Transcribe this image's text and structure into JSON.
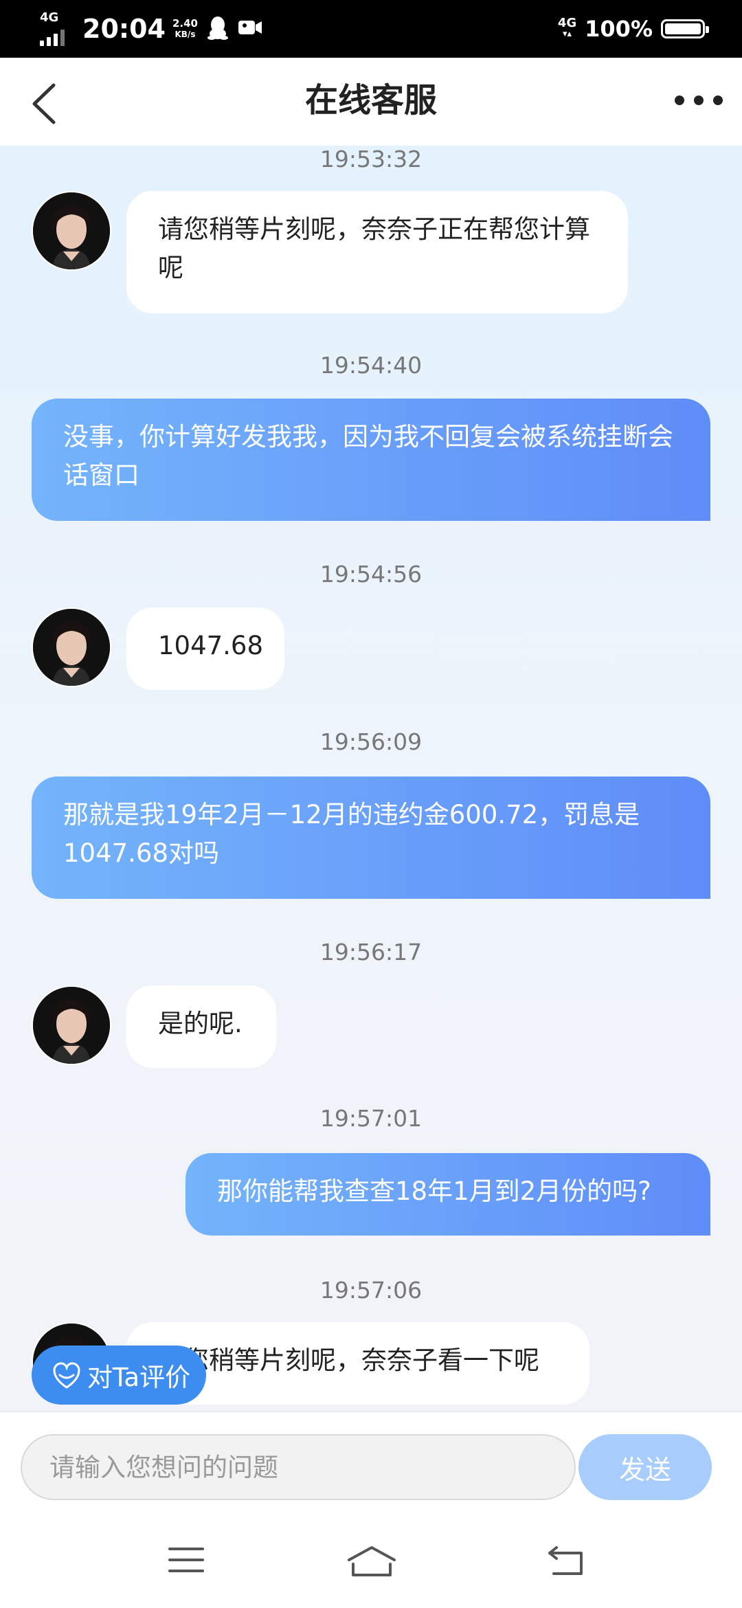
{
  "status_bar": {
    "network_left": "4G",
    "time": "20:04",
    "speed_value": "2.40",
    "speed_unit": "KB/s",
    "network_right": "4G",
    "battery_pct": "100%",
    "battery_level": 1.0
  },
  "header": {
    "title": "在线客服"
  },
  "messages": [
    {
      "time": "19:53:32",
      "from": "agent",
      "text": "请您稍等片刻呢，奈奈子正在帮您计算呢"
    },
    {
      "time": "19:54:40",
      "from": "user",
      "text": "没事，你计算好发我我，因为我不回复会被系统挂断会话窗口"
    },
    {
      "time": "19:54:56",
      "from": "agent",
      "text": "1047.68"
    },
    {
      "time": "19:56:09",
      "from": "user",
      "text": "那就是我19年2月－12月的违约金600.72，罚息是1047.68对吗"
    },
    {
      "time": "19:56:17",
      "from": "agent",
      "text": "是的呢."
    },
    {
      "time": "19:57:01",
      "from": "user",
      "text": "那你能帮我查查18年1月到2月份的吗?"
    },
    {
      "time": "19:57:06",
      "from": "agent",
      "text": "请您稍等片刻呢，奈奈子看一下呢"
    }
  ],
  "rate_button": {
    "label": "对Ta评价"
  },
  "input": {
    "placeholder": "请输入您想问的问题",
    "value": ""
  },
  "send_button": {
    "label": "发送"
  },
  "colors": {
    "outgoing_bubble_start": "#74b4fb",
    "outgoing_bubble_end": "#5f8df8",
    "send_button": "#a8cdfc",
    "rate_button": "#3d8df0"
  }
}
